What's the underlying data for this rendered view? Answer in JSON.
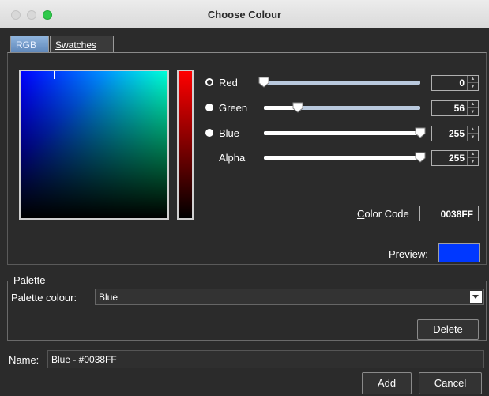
{
  "window": {
    "title": "Choose Colour"
  },
  "tabs": [
    {
      "label": "RGB",
      "active": true
    },
    {
      "label": "Swatches",
      "active": false
    }
  ],
  "channels": [
    {
      "label": "Red",
      "value": "0",
      "selected": true
    },
    {
      "label": "Green",
      "value": "56",
      "selected": false
    },
    {
      "label": "Blue",
      "value": "255",
      "selected": false
    },
    {
      "label": "Alpha",
      "value": "255",
      "selected": false
    }
  ],
  "slider_levels": {
    "red": 0,
    "green": 56,
    "blue": 255,
    "alpha": 255,
    "max": 255
  },
  "color_code": {
    "label": "Color Code",
    "value": "0038FF"
  },
  "preview": {
    "label": "Preview:",
    "color": "#0038FF"
  },
  "palette": {
    "legend": "Palette",
    "colour_label": "Palette colour:",
    "selected": "Blue",
    "delete_label": "Delete"
  },
  "name": {
    "label": "Name:",
    "value": "Blue - #0038FF"
  },
  "buttons": {
    "add": "Add",
    "cancel": "Cancel"
  },
  "icons": {
    "close": "close-icon",
    "minimize": "minimize-icon",
    "maximize": "maximize-icon"
  }
}
